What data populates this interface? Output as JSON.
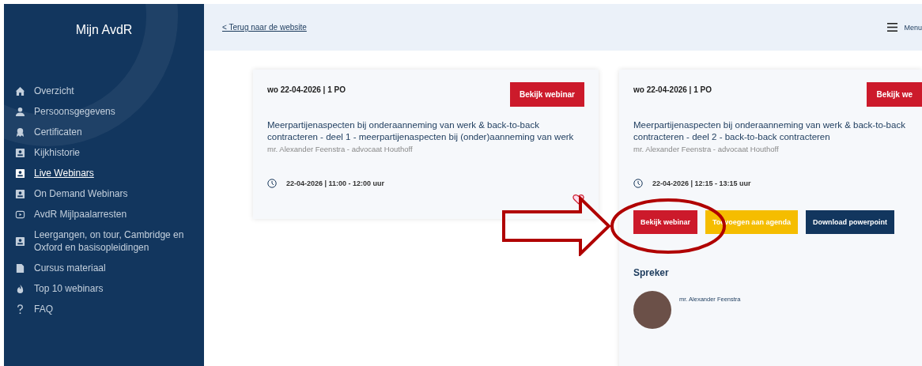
{
  "sidebar": {
    "title": "Mijn AvdR",
    "items": [
      {
        "label": "Overzicht",
        "kind": "home",
        "selected": false
      },
      {
        "label": "Persoonsgegevens",
        "kind": "person",
        "selected": false
      },
      {
        "label": "Certificaten",
        "kind": "award",
        "selected": false
      },
      {
        "label": "Kijkhistorie",
        "kind": "badge",
        "selected": false
      },
      {
        "label": "Live Webinars",
        "kind": "badge",
        "selected": true
      },
      {
        "label": "On Demand Webinars",
        "kind": "badge",
        "selected": false
      },
      {
        "label": "AvdR Mijlpaalarresten",
        "kind": "play",
        "selected": false
      },
      {
        "label": "Leergangen, on tour, Cambridge en Oxford en basisopleidingen",
        "kind": "badge",
        "selected": false
      },
      {
        "label": "Cursus materiaal",
        "kind": "doc",
        "selected": false
      },
      {
        "label": "Top 10 webinars",
        "kind": "flame",
        "selected": false
      },
      {
        "label": "FAQ",
        "kind": "question",
        "selected": false
      }
    ]
  },
  "header": {
    "back_link": "< Terug naar de website",
    "menu_label": "Menu"
  },
  "cards": [
    {
      "date": "wo 22-04-2026 | 1 PO",
      "top_button": "Bekijk webinar",
      "title": "Meerpartijenaspecten bij onderaanneming van werk & back-to-back contracteren - deel 1 - meerpartijenaspecten bij (onder)aanneming van werk",
      "speaker_line": "mr. Alexander Feenstra - advocaat Houthoff",
      "time": "22-04-2026 | 11:00 - 12:00 uur",
      "favorite": true
    },
    {
      "date": "wo 22-04-2026 | 1 PO",
      "top_button": "Bekijk we",
      "title": "Meerpartijenaspecten bij onderaanneming van werk & back-to-back contracteren - deel 2 - back-to-back contracteren",
      "speaker_line": "mr. Alexander Feenstra - advocaat Houthoff",
      "time": "22-04-2026 | 12:15 - 13:15 uur",
      "actions": [
        {
          "label": "Bekijk webinar",
          "kind": "primary"
        },
        {
          "label": "Toevoegen aan agenda",
          "kind": "warning"
        },
        {
          "label": "Download powerpoint",
          "kind": "dark"
        }
      ],
      "speaker_heading": "Spreker",
      "speaker_name": "mr. Alexander Feenstra"
    }
  ]
}
